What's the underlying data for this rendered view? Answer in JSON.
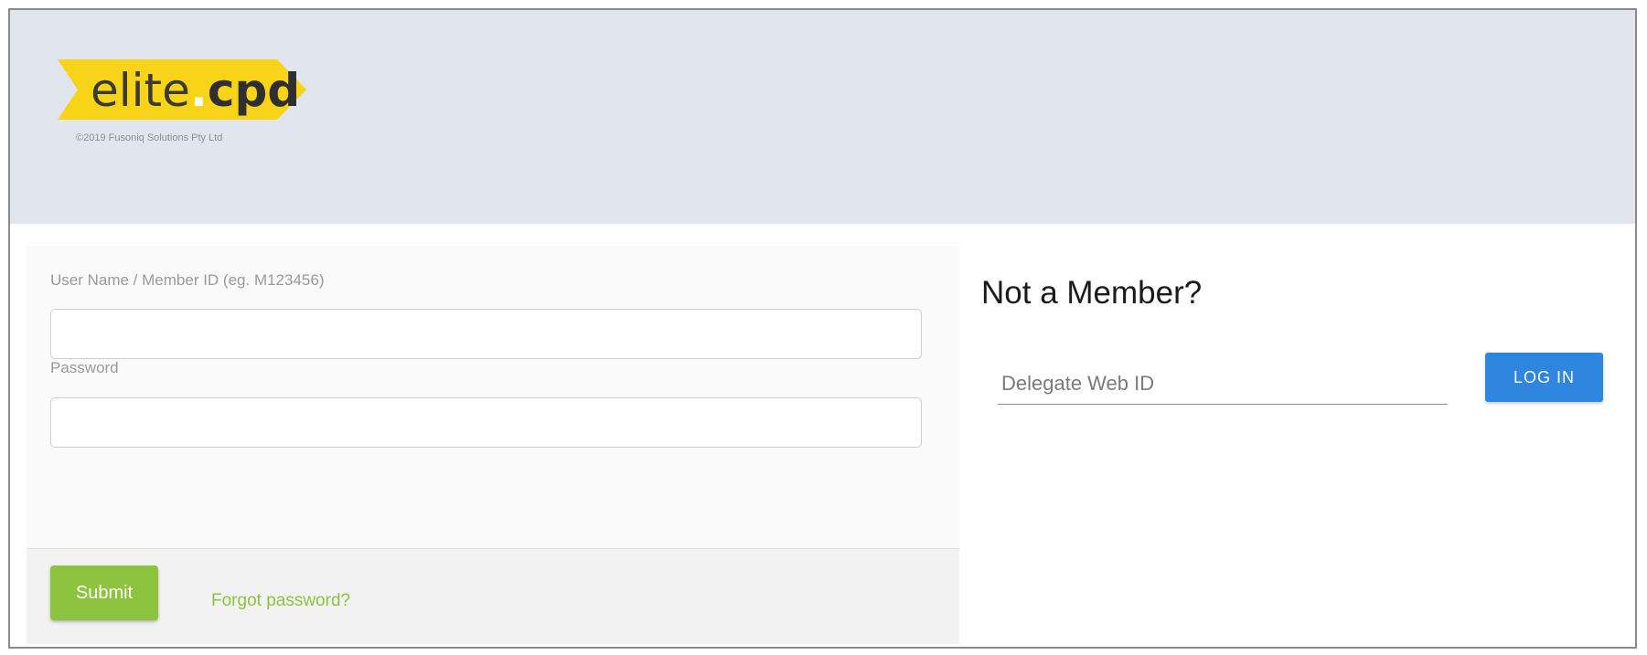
{
  "header": {
    "logo": {
      "name_prefix": "elite",
      "name_dot": ".",
      "name_suffix": "cpd",
      "banner_color": "#f7d417"
    },
    "copyright": "©2019 Fusoniq Solutions Pty Ltd"
  },
  "login_form": {
    "username": {
      "label": "User Name / Member ID (eg. M123456)",
      "value": "",
      "placeholder": ""
    },
    "password": {
      "label": "Password",
      "value": "",
      "placeholder": ""
    },
    "submit_label": "Submit",
    "forgot_label": "Forgot password?",
    "accent_color": "#8cc43f"
  },
  "delegate": {
    "title": "Not a Member?",
    "input_placeholder": "Delegate Web ID",
    "input_value": "",
    "login_label": "LOG IN",
    "button_color": "#2e86de"
  }
}
